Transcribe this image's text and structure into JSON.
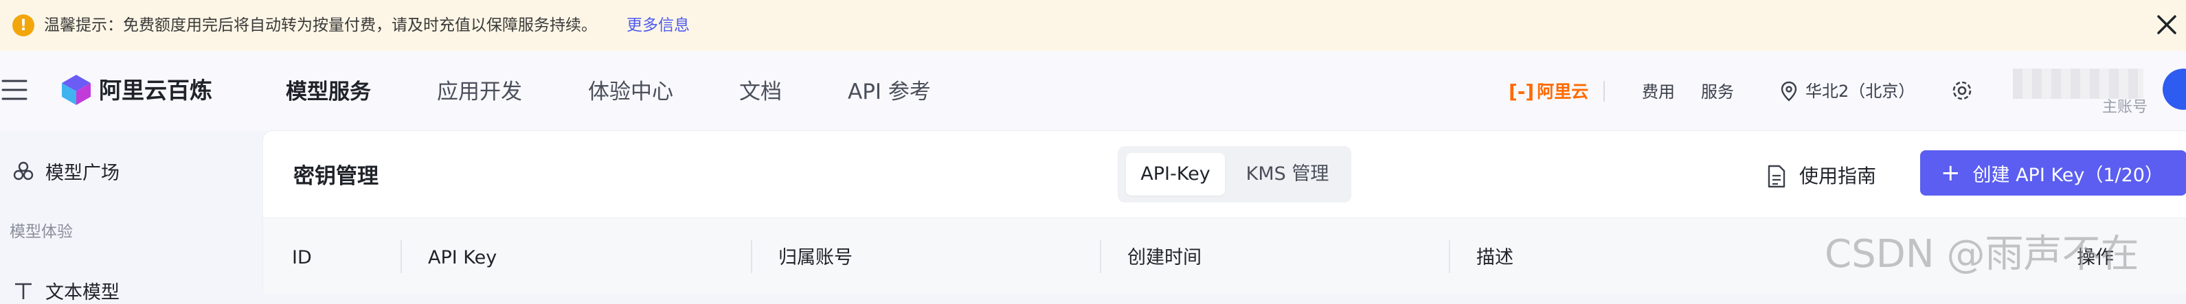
{
  "notice": {
    "text": "温馨提示：免费额度用完后将自动转为按量付费，请及时充值以保障服务持续。",
    "more_link": "更多信息",
    "warn_glyph": "!"
  },
  "header": {
    "brand": "阿里云百炼",
    "nav": [
      "模型服务",
      "应用开发",
      "体验中心",
      "文档",
      "API 参考"
    ],
    "active_nav": "模型服务",
    "aliyun_bracket": "[-]",
    "aliyun_label": "阿里云",
    "fees": "费用",
    "service": "服务",
    "region": "华北2（北京）",
    "account_label": "主账号"
  },
  "sidebar": {
    "item_model_square": "模型广场",
    "group_model_experience": "模型体验",
    "item_text_model": "文本模型"
  },
  "main": {
    "title": "密钥管理",
    "tabs": [
      "API-Key",
      "KMS 管理"
    ],
    "selected_tab": "API-Key",
    "guide": "使用指南",
    "create_button": "创建 API Key（1/20）",
    "columns": [
      "ID",
      "API Key",
      "归属账号",
      "创建时间",
      "描述",
      "操作"
    ]
  },
  "watermark": "CSDN @雨声不在",
  "colors": {
    "accent": "#5b5ef0",
    "aliyun_orange": "#ff6a00",
    "notice_bg": "#fdf6e6",
    "warn": "#f2a60c"
  },
  "icons": [
    "warning-icon",
    "close-icon",
    "menu-icon",
    "bailian-logo",
    "aliyun-logo",
    "location-pin-icon",
    "gear-icon",
    "avatar",
    "model-square-icon",
    "text-model-icon",
    "document-icon",
    "plus-icon"
  ]
}
